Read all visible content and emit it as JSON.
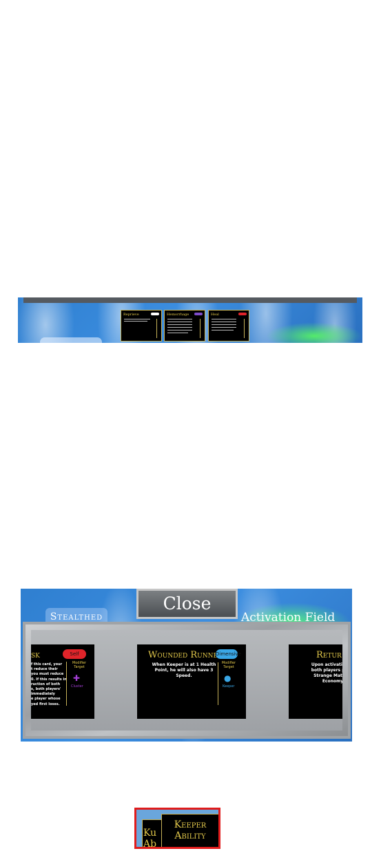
{
  "top_panel": {
    "cards": [
      {
        "title": "Reprieve",
        "tag_color": "#ffffff"
      },
      {
        "title": "Hemorrhage",
        "tag_color": "#7d4cc9"
      },
      {
        "title": "Heal",
        "tag_color": "#e0242a"
      }
    ]
  },
  "bottom_panel": {
    "close_label": "Close",
    "stealthed_label": "Stealthed",
    "activation_label": "Activation Field",
    "cards": [
      {
        "title": "sk",
        "badge": "Self",
        "badge_color": "#e0242a",
        "body": "f this card, your\nt reduce their\nyou must reduce\n0. If this results in\nruction of both\ns, both players'\nimmediately\ne player whose\nyed first loses.",
        "modifier": "Modifier\nTarget",
        "icon": "plus-icon",
        "icon_label": "Cluster"
      },
      {
        "title": "Wounded Runner",
        "badge": "Dimensive",
        "badge_color": "#3aa7e6",
        "body": "When Keeper is at 1 Health\nPoint, he will also have 3\nSpeed.",
        "modifier": "Modifier\nTarget",
        "icon": "keeper-icon",
        "icon_label": "Keeper"
      },
      {
        "title": "Retur",
        "body": "Upon activation of\nboth players place\nStrange Matter i\nEconomy"
      }
    ]
  },
  "keeper_button": {
    "back_label": "Ku\nAb",
    "front_label": "Keeper\nAbility"
  }
}
